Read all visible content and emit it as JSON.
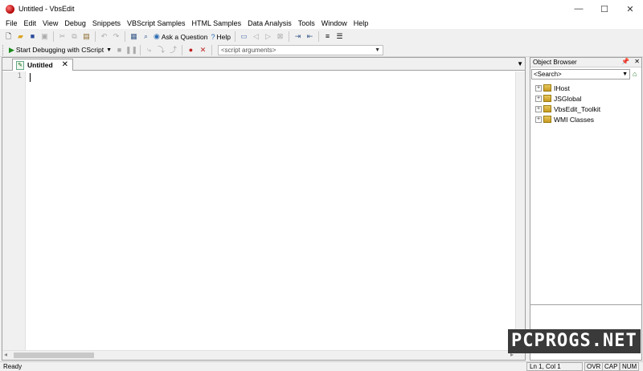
{
  "window": {
    "title": "Untitled - VbsEdit",
    "controls": {
      "minimize": "—",
      "maximize": "☐",
      "close": "✕"
    }
  },
  "menu": [
    "File",
    "Edit",
    "View",
    "Debug",
    "Snippets",
    "VBScript Samples",
    "HTML Samples",
    "Data Analysis",
    "Tools",
    "Window",
    "Help"
  ],
  "toolbar1": {
    "ask_question": "Ask a Question",
    "help": "Help"
  },
  "toolbar2": {
    "start_debugging": "Start Debugging with CScript",
    "script_args_placeholder": "<script arguments>"
  },
  "editor": {
    "tab_label": "Untitled",
    "tab_close": "✕",
    "line_numbers": [
      "1"
    ]
  },
  "object_browser": {
    "title": "Object Browser",
    "search_placeholder": "<Search>",
    "items": [
      "IHost",
      "JSGlobal",
      "VbsEdit_Toolkit",
      "WMI Classes"
    ]
  },
  "status": {
    "left": "Ready",
    "position": "Ln 1, Col 1",
    "ovr": "OVR",
    "cap": "CAP",
    "num": "NUM"
  },
  "watermark": "PCPROGS.NET"
}
